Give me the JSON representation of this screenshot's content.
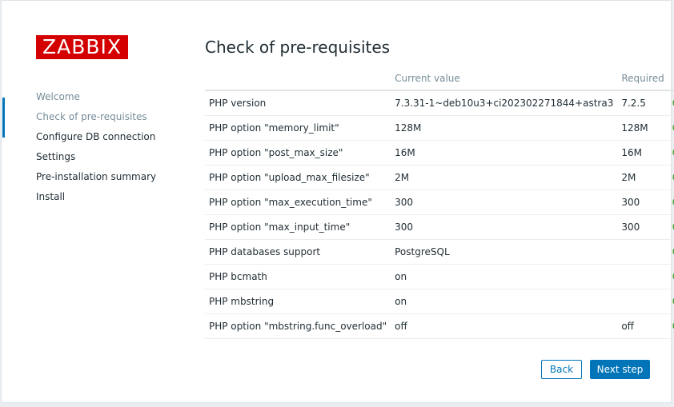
{
  "brand": {
    "logo_text": "ZABBIX",
    "accent_color": "#d40000",
    "link_color": "#0275b8",
    "ok_color": "#3a9a1a"
  },
  "sidebar": {
    "steps": [
      {
        "label": "Welcome",
        "state": "done"
      },
      {
        "label": "Check of pre-requisites",
        "state": "active"
      },
      {
        "label": "Configure DB connection",
        "state": "pending"
      },
      {
        "label": "Settings",
        "state": "pending"
      },
      {
        "label": "Pre-installation summary",
        "state": "pending"
      },
      {
        "label": "Install",
        "state": "pending"
      }
    ]
  },
  "main": {
    "title": "Check of pre-requisites",
    "table": {
      "headers": [
        "",
        "Current value",
        "Required",
        ""
      ],
      "rows": [
        {
          "name": "PHP version",
          "current": "7.3.31-1~deb10u3+ci202302271844+astra3",
          "required": "7.2.5",
          "status": "OK"
        },
        {
          "name": "PHP option \"memory_limit\"",
          "current": "128M",
          "required": "128M",
          "status": "OK"
        },
        {
          "name": "PHP option \"post_max_size\"",
          "current": "16M",
          "required": "16M",
          "status": "OK"
        },
        {
          "name": "PHP option \"upload_max_filesize\"",
          "current": "2M",
          "required": "2M",
          "status": "OK"
        },
        {
          "name": "PHP option \"max_execution_time\"",
          "current": "300",
          "required": "300",
          "status": "OK"
        },
        {
          "name": "PHP option \"max_input_time\"",
          "current": "300",
          "required": "300",
          "status": "OK"
        },
        {
          "name": "PHP databases support",
          "current": "PostgreSQL",
          "required": "",
          "status": "OK"
        },
        {
          "name": "PHP bcmath",
          "current": "on",
          "required": "",
          "status": "OK"
        },
        {
          "name": "PHP mbstring",
          "current": "on",
          "required": "",
          "status": "OK"
        },
        {
          "name": "PHP option \"mbstring.func_overload\"",
          "current": "off",
          "required": "off",
          "status": "OK"
        }
      ]
    }
  },
  "buttons": {
    "back": "Back",
    "next": "Next step"
  }
}
